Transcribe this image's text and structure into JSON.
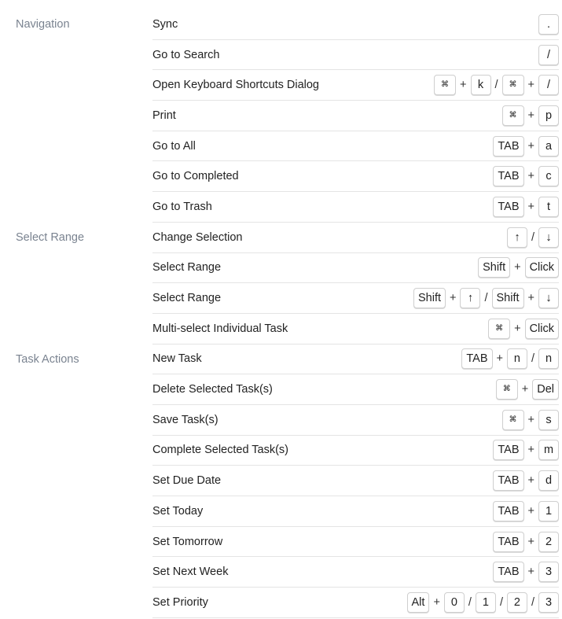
{
  "sections": [
    {
      "label": "Navigation",
      "rows": [
        {
          "name": "Sync",
          "keys": [
            [
              "k",
              "."
            ]
          ]
        },
        {
          "name": "Go to Search",
          "keys": [
            [
              "k",
              "/"
            ]
          ]
        },
        {
          "name": "Open Keyboard Shortcuts Dialog",
          "keys": [
            [
              "k",
              "⌘"
            ],
            [
              "s",
              "+"
            ],
            [
              "k",
              "k"
            ],
            [
              "s",
              "/"
            ],
            [
              "k",
              "⌘"
            ],
            [
              "s",
              "+"
            ],
            [
              "k",
              "/"
            ]
          ]
        },
        {
          "name": "Print",
          "keys": [
            [
              "k",
              "⌘"
            ],
            [
              "s",
              "+"
            ],
            [
              "k",
              "p"
            ]
          ]
        },
        {
          "name": "Go to All",
          "keys": [
            [
              "k",
              "TAB"
            ],
            [
              "s",
              "+"
            ],
            [
              "k",
              "a"
            ]
          ]
        },
        {
          "name": "Go to Completed",
          "keys": [
            [
              "k",
              "TAB"
            ],
            [
              "s",
              "+"
            ],
            [
              "k",
              "c"
            ]
          ]
        },
        {
          "name": "Go to Trash",
          "keys": [
            [
              "k",
              "TAB"
            ],
            [
              "s",
              "+"
            ],
            [
              "k",
              "t"
            ]
          ]
        }
      ]
    },
    {
      "label": "Select Range",
      "rows": [
        {
          "name": "Change Selection",
          "keys": [
            [
              "k",
              "↑"
            ],
            [
              "s",
              "/"
            ],
            [
              "k",
              "↓"
            ]
          ]
        },
        {
          "name": "Select Range",
          "keys": [
            [
              "k",
              "Shift"
            ],
            [
              "s",
              "+"
            ],
            [
              "k",
              "Click"
            ]
          ]
        },
        {
          "name": "Select Range",
          "keys": [
            [
              "k",
              "Shift"
            ],
            [
              "s",
              "+"
            ],
            [
              "k",
              "↑"
            ],
            [
              "s",
              "/"
            ],
            [
              "k",
              "Shift"
            ],
            [
              "s",
              "+"
            ],
            [
              "k",
              "↓"
            ]
          ]
        },
        {
          "name": "Multi-select Individual Task",
          "keys": [
            [
              "k",
              "⌘"
            ],
            [
              "s",
              "+"
            ],
            [
              "k",
              "Click"
            ]
          ]
        }
      ]
    },
    {
      "label": "Task Actions",
      "rows": [
        {
          "name": "New Task",
          "keys": [
            [
              "k",
              "TAB"
            ],
            [
              "s",
              "+"
            ],
            [
              "k",
              "n"
            ],
            [
              "s",
              "/"
            ],
            [
              "k",
              "n"
            ]
          ]
        },
        {
          "name": "Delete Selected Task(s)",
          "keys": [
            [
              "k",
              "⌘"
            ],
            [
              "s",
              "+"
            ],
            [
              "k",
              "Del"
            ]
          ]
        },
        {
          "name": "Save Task(s)",
          "keys": [
            [
              "k",
              "⌘"
            ],
            [
              "s",
              "+"
            ],
            [
              "k",
              "s"
            ]
          ]
        },
        {
          "name": "Complete Selected Task(s)",
          "keys": [
            [
              "k",
              "TAB"
            ],
            [
              "s",
              "+"
            ],
            [
              "k",
              "m"
            ]
          ]
        },
        {
          "name": "Set Due Date",
          "keys": [
            [
              "k",
              "TAB"
            ],
            [
              "s",
              "+"
            ],
            [
              "k",
              "d"
            ]
          ]
        },
        {
          "name": "Set Today",
          "keys": [
            [
              "k",
              "TAB"
            ],
            [
              "s",
              "+"
            ],
            [
              "k",
              "1"
            ]
          ]
        },
        {
          "name": "Set Tomorrow",
          "keys": [
            [
              "k",
              "TAB"
            ],
            [
              "s",
              "+"
            ],
            [
              "k",
              "2"
            ]
          ]
        },
        {
          "name": "Set Next Week",
          "keys": [
            [
              "k",
              "TAB"
            ],
            [
              "s",
              "+"
            ],
            [
              "k",
              "3"
            ]
          ]
        },
        {
          "name": "Set Priority",
          "keys": [
            [
              "k",
              "Alt"
            ],
            [
              "s",
              "+"
            ],
            [
              "k",
              "0"
            ],
            [
              "s",
              "/"
            ],
            [
              "k",
              "1"
            ],
            [
              "s",
              "/"
            ],
            [
              "k",
              "2"
            ],
            [
              "s",
              "/"
            ],
            [
              "k",
              "3"
            ]
          ]
        }
      ]
    }
  ]
}
